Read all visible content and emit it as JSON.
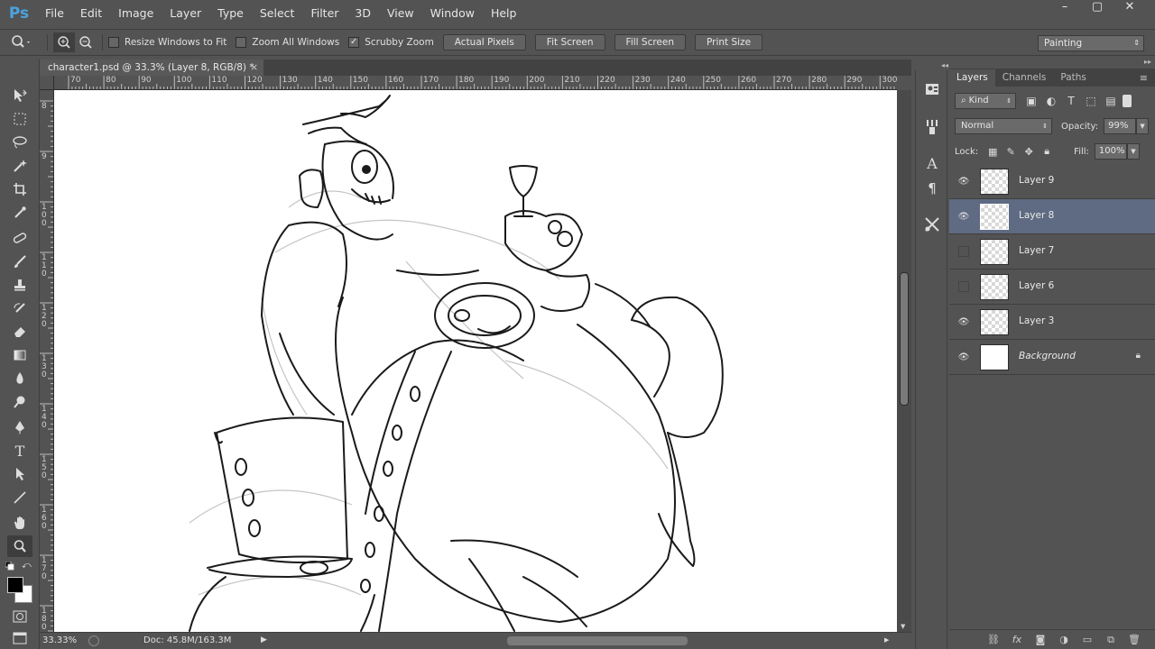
{
  "app": {
    "logo": "Ps"
  },
  "menu": [
    "File",
    "Edit",
    "Image",
    "Layer",
    "Type",
    "Select",
    "Filter",
    "3D",
    "View",
    "Window",
    "Help"
  ],
  "window_controls": {
    "minimize": "–",
    "maximize": "▢",
    "close": "✕"
  },
  "options": {
    "checkboxes": [
      {
        "label": "Resize Windows to Fit",
        "checked": false
      },
      {
        "label": "Zoom All Windows",
        "checked": false
      },
      {
        "label": "Scrubby Zoom",
        "checked": true
      }
    ],
    "buttons": [
      "Actual Pixels",
      "Fit Screen",
      "Fill Screen",
      "Print Size"
    ],
    "workspace": "Painting"
  },
  "document": {
    "tab_title": "character1.psd @ 33.3% (Layer 8, RGB/8) *",
    "close_glyph": "×",
    "zoom": "33.33%",
    "doc_info": "Doc: 45.8M/163.3M"
  },
  "ruler": {
    "h_labels": [
      "70",
      "80",
      "90",
      "100",
      "110",
      "120",
      "130",
      "140",
      "150",
      "160",
      "170",
      "180",
      "190",
      "200",
      "210",
      "220",
      "230",
      "240",
      "250",
      "260",
      "270",
      "280",
      "290",
      "300"
    ],
    "v_labels": [
      "8",
      "9",
      "100",
      "110",
      "120",
      "130",
      "140",
      "150",
      "160",
      "170",
      "180"
    ]
  },
  "panels": {
    "tabs": [
      "Layers",
      "Channels",
      "Paths"
    ],
    "filter_kind": "Kind",
    "blend_mode": "Normal",
    "opacity_label": "Opacity:",
    "opacity_value": "99%",
    "lock_label": "Lock:",
    "fill_label": "Fill:",
    "fill_value": "100%",
    "layers": [
      {
        "name": "Layer 9",
        "visible": true,
        "selected": false
      },
      {
        "name": "Layer 8",
        "visible": true,
        "selected": true
      },
      {
        "name": "Layer 7",
        "visible": false,
        "selected": false
      },
      {
        "name": "Layer 6",
        "visible": false,
        "selected": false
      },
      {
        "name": "Layer 3",
        "visible": true,
        "selected": false
      },
      {
        "name": "Background",
        "visible": true,
        "selected": false,
        "locked": true
      }
    ]
  },
  "colors": {
    "ui_bg": "#535353",
    "selected_layer": "#5f6b82",
    "ps_blue": "#4aa3df"
  }
}
